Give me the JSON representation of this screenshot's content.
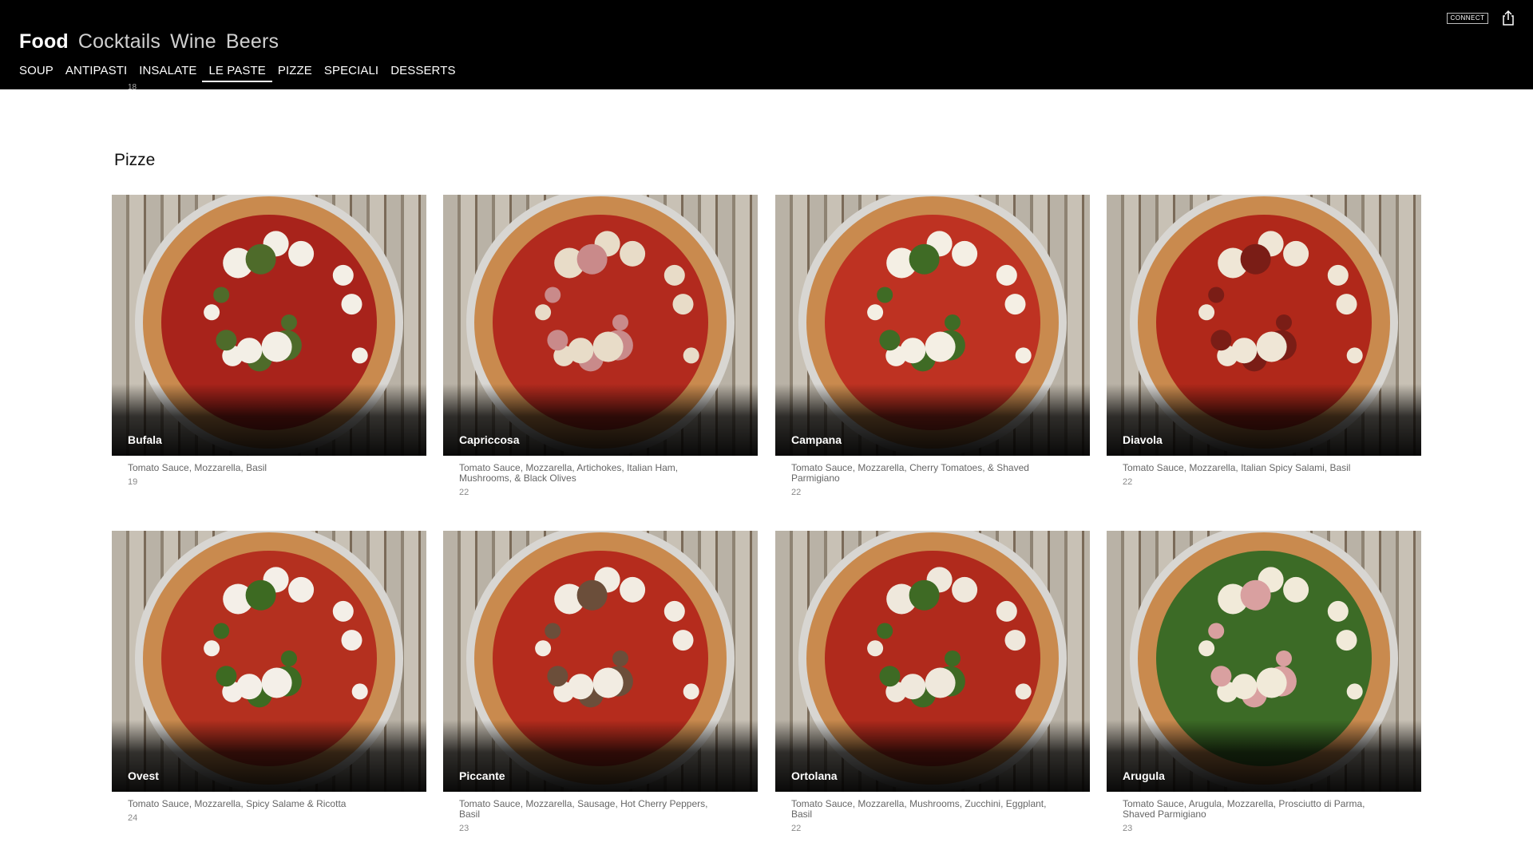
{
  "header": {
    "main_nav": [
      "Food",
      "Cocktails",
      "Wine",
      "Beers"
    ],
    "sub_nav": [
      "SOUP",
      "ANTIPASTI",
      "INSALATE",
      "LE PASTE",
      "PIZZE",
      "SPECIALI",
      "DESSERTS"
    ],
    "connect_label": "CONNECT",
    "share_icon": "share-icon"
  },
  "prev_section_price": "18",
  "section": {
    "title": "Pizze",
    "items": [
      {
        "name": "Bufala",
        "desc": "Tomato Sauce, Mozzarella, Basil",
        "price": "19",
        "topping": "#a8231b",
        "accent": "#4e6b2a",
        "cheese": "#f3efe6"
      },
      {
        "name": "Capriccosa",
        "desc": "Tomato Sauce, Mozzarella, Artichokes, Italian Ham, Mushrooms, & Black Olives",
        "price": "22",
        "topping": "#b22a1e",
        "accent": "#c98a8a",
        "cheese": "#e8dcc8"
      },
      {
        "name": "Campana",
        "desc": "Tomato Sauce, Mozzarella, Cherry Tomatoes, & Shaved Parmigiano",
        "price": "22",
        "topping": "#be3222",
        "accent": "#3f6b25",
        "cheese": "#f4efe4"
      },
      {
        "name": "Diavola",
        "desc": "Tomato Sauce, Mozzarella, Italian Spicy Salami, Basil",
        "price": "22",
        "topping": "#b0281a",
        "accent": "#7a1d16",
        "cheese": "#efe6d6"
      },
      {
        "name": "Ovest",
        "desc": "Tomato Sauce, Mozzarella, Spicy Salame & Ricotta",
        "price": "24",
        "topping": "#b4301f",
        "accent": "#3d6a22",
        "cheese": "#f4efe8"
      },
      {
        "name": "Piccante",
        "desc": "Tomato Sauce, Mozzarella, Sausage, Hot Cherry Peppers, Basil",
        "price": "23",
        "topping": "#b52c1d",
        "accent": "#6b4e3a",
        "cheese": "#f2ece2"
      },
      {
        "name": "Ortolana",
        "desc": "Tomato Sauce, Mozzarella, Mushrooms, Zucchini, Eggplant, Basil",
        "price": "22",
        "topping": "#b02a1c",
        "accent": "#3e6a24",
        "cheese": "#efe8dc"
      },
      {
        "name": "Arugula",
        "desc": "Tomato Sauce, Arugula, Mozzarella, Prosciutto di Parma, Shaved Parmigiano",
        "price": "23",
        "topping": "#3c6b26",
        "accent": "#d9a0a0",
        "cheese": "#f1ead9"
      }
    ]
  }
}
